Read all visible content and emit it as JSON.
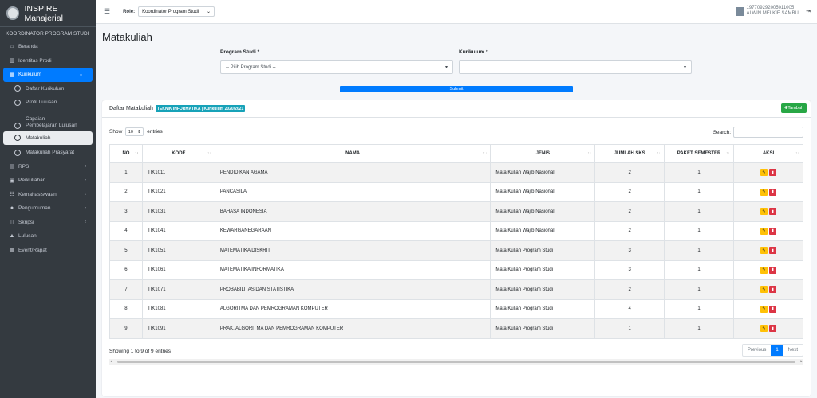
{
  "app": {
    "title": "INSPIRE Manajerial"
  },
  "sidebar": {
    "header": "KOORDINATOR PROGRAM STUDI",
    "items": [
      {
        "label": "Beranda",
        "icon": "home-icon",
        "glyph": "⌂"
      },
      {
        "label": "Identitas Prodi",
        "icon": "institution-icon",
        "glyph": "▥"
      },
      {
        "label": "Kurikulum",
        "icon": "table-icon",
        "glyph": "▦"
      },
      {
        "label": "RPS",
        "icon": "book-icon",
        "glyph": "▤"
      },
      {
        "label": "Perkuliahan",
        "icon": "briefcase-icon",
        "glyph": "▣"
      },
      {
        "label": "Kemahasiswaan",
        "icon": "users-icon",
        "glyph": "☷"
      },
      {
        "label": "Pengumuman",
        "icon": "info-icon",
        "glyph": "●"
      },
      {
        "label": "Skripsi",
        "icon": "file-icon",
        "glyph": "▯"
      },
      {
        "label": "Lulusan",
        "icon": "graduation-icon",
        "glyph": "▲"
      },
      {
        "label": "Event/Rapat",
        "icon": "calendar-icon",
        "glyph": "▦"
      }
    ],
    "sub": [
      {
        "label": "Daftar Kurikulum"
      },
      {
        "label": "Profil Lulusan"
      },
      {
        "label1": "Capaian",
        "label2": "Pembelajaran Lulusan"
      },
      {
        "label": "Matakuliah"
      },
      {
        "label": "Matakuliah Prasyarat"
      }
    ]
  },
  "topbar": {
    "role_label": "Role:",
    "role_value": "Koordinator Program Studi",
    "user_id": "197709292005011005",
    "user_name": "ALWIN MELKIE SAMBUL"
  },
  "page": {
    "title": "Matakuliah"
  },
  "form": {
    "prodi_label": "Program Studi *",
    "prodi_value": "-- Pilih Program Studi --",
    "kurikulum_label": "Kurikulum *",
    "kurikulum_value": "",
    "submit": "Submit"
  },
  "card": {
    "title": "Daftar Matakuliah",
    "badge": "TEKNIK INFORMATIKA | Kurikulum 2020/2021",
    "add": "Tambah",
    "show": "Show",
    "entries_value": "10",
    "entries": "entries",
    "search": "Search:",
    "info": "Showing 1 to 9 of 9 entries",
    "prev": "Previous",
    "page": "1",
    "next": "Next"
  },
  "table": {
    "headers": [
      "NO",
      "KODE",
      "NAMA",
      "JENIS",
      "JUMLAH SKS",
      "PAKET SEMESTER",
      "AKSI"
    ],
    "rows": [
      {
        "no": "1",
        "kode": "TIK1011",
        "nama": "PENDIDIKAN AGAMA",
        "jenis": "Mata Kuliah Wajib Nasional",
        "sks": "2",
        "sem": "1"
      },
      {
        "no": "2",
        "kode": "TIK1021",
        "nama": "PANCASILA",
        "jenis": "Mata Kuliah Wajib Nasional",
        "sks": "2",
        "sem": "1"
      },
      {
        "no": "3",
        "kode": "TIK1031",
        "nama": "BAHASA INDONESIA",
        "jenis": "Mata Kuliah Wajib Nasional",
        "sks": "2",
        "sem": "1"
      },
      {
        "no": "4",
        "kode": "TIK1041",
        "nama": "KEWARGANEGARAAN",
        "jenis": "Mata Kuliah Wajib Nasional",
        "sks": "2",
        "sem": "1"
      },
      {
        "no": "5",
        "kode": "TIK1051",
        "nama": "MATEMATIKA DISKRIT",
        "jenis": "Mata Kuliah Program Studi",
        "sks": "3",
        "sem": "1"
      },
      {
        "no": "6",
        "kode": "TIK1061",
        "nama": "MATEMATIKA INFORMATIKA",
        "jenis": "Mata Kuliah Program Studi",
        "sks": "3",
        "sem": "1"
      },
      {
        "no": "7",
        "kode": "TIK1071",
        "nama": "PROBABILITAS DAN STATISTIKA",
        "jenis": "Mata Kuliah Program Studi",
        "sks": "2",
        "sem": "1"
      },
      {
        "no": "8",
        "kode": "TIK1081",
        "nama": "ALGORITMA DAN PEMROGRAMAN KOMPUTER",
        "jenis": "Mata Kuliah Program Studi",
        "sks": "4",
        "sem": "1"
      },
      {
        "no": "9",
        "kode": "TIK1091",
        "nama": "PRAK. ALGORITMA DAN PEMROGRAMAN KOMPUTER",
        "jenis": "Mata Kuliah Program Studi",
        "sks": "1",
        "sem": "1"
      }
    ]
  },
  "colors": {
    "primary": "#007bff",
    "sidebar": "#343a40",
    "success": "#28a745",
    "warning": "#ffc107",
    "danger": "#dc3545",
    "info": "#17a2b8"
  }
}
